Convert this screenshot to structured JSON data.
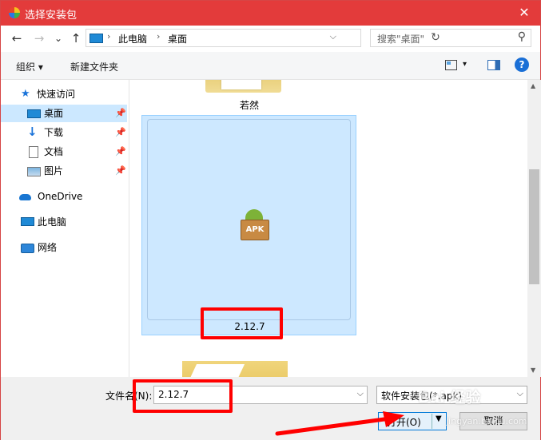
{
  "titlebar": {
    "title": "选择安装包",
    "close_glyph": "✕"
  },
  "nav": {
    "back_glyph": "←",
    "forward_glyph": "→",
    "history_glyph": "⌄",
    "up_glyph": "↑",
    "breadcrumb": [
      "此电脑",
      "桌面"
    ],
    "crumb_sep": "›",
    "address_dropdown": "⌵",
    "refresh_glyph": "↻",
    "search_placeholder": "搜索\"桌面\"",
    "search_glyph": "⚲"
  },
  "toolbar": {
    "organize": "组织 ▾",
    "new_folder": "新建文件夹",
    "view_dropdown": "▾",
    "help": "?"
  },
  "sidebar": {
    "items": [
      {
        "label": "快速访问",
        "icon": "star-icon"
      },
      {
        "label": "桌面",
        "icon": "desktop-icon",
        "selected": true,
        "pinned": true
      },
      {
        "label": "下载",
        "icon": "download-icon",
        "pinned": true
      },
      {
        "label": "文档",
        "icon": "document-icon",
        "pinned": true
      },
      {
        "label": "图片",
        "icon": "pictures-icon",
        "pinned": true
      },
      {
        "label": "OneDrive",
        "icon": "cloud-icon"
      },
      {
        "label": "此电脑",
        "icon": "computer-icon"
      },
      {
        "label": "网络",
        "icon": "network-icon"
      }
    ],
    "pin_glyph": "📌"
  },
  "content": {
    "folder_label": "若然",
    "selected_file": {
      "name": "2.12.7",
      "icon_text": "APK"
    }
  },
  "bottom": {
    "filename_label": "文件名(N):",
    "filename_value": "2.12.7",
    "filter_value": "软件安装包(*.apk)",
    "open_button": "打开(O)",
    "cancel_button": "取消",
    "dropdown_glyph": "⌵"
  },
  "colors": {
    "titlebar": "#e33b3b",
    "selection": "#cde8ff",
    "highlight": "#ff0000",
    "accent": "#0078d7"
  },
  "watermark": {
    "main": "Bai 经验",
    "sub": "jingyan.baidu.com"
  }
}
